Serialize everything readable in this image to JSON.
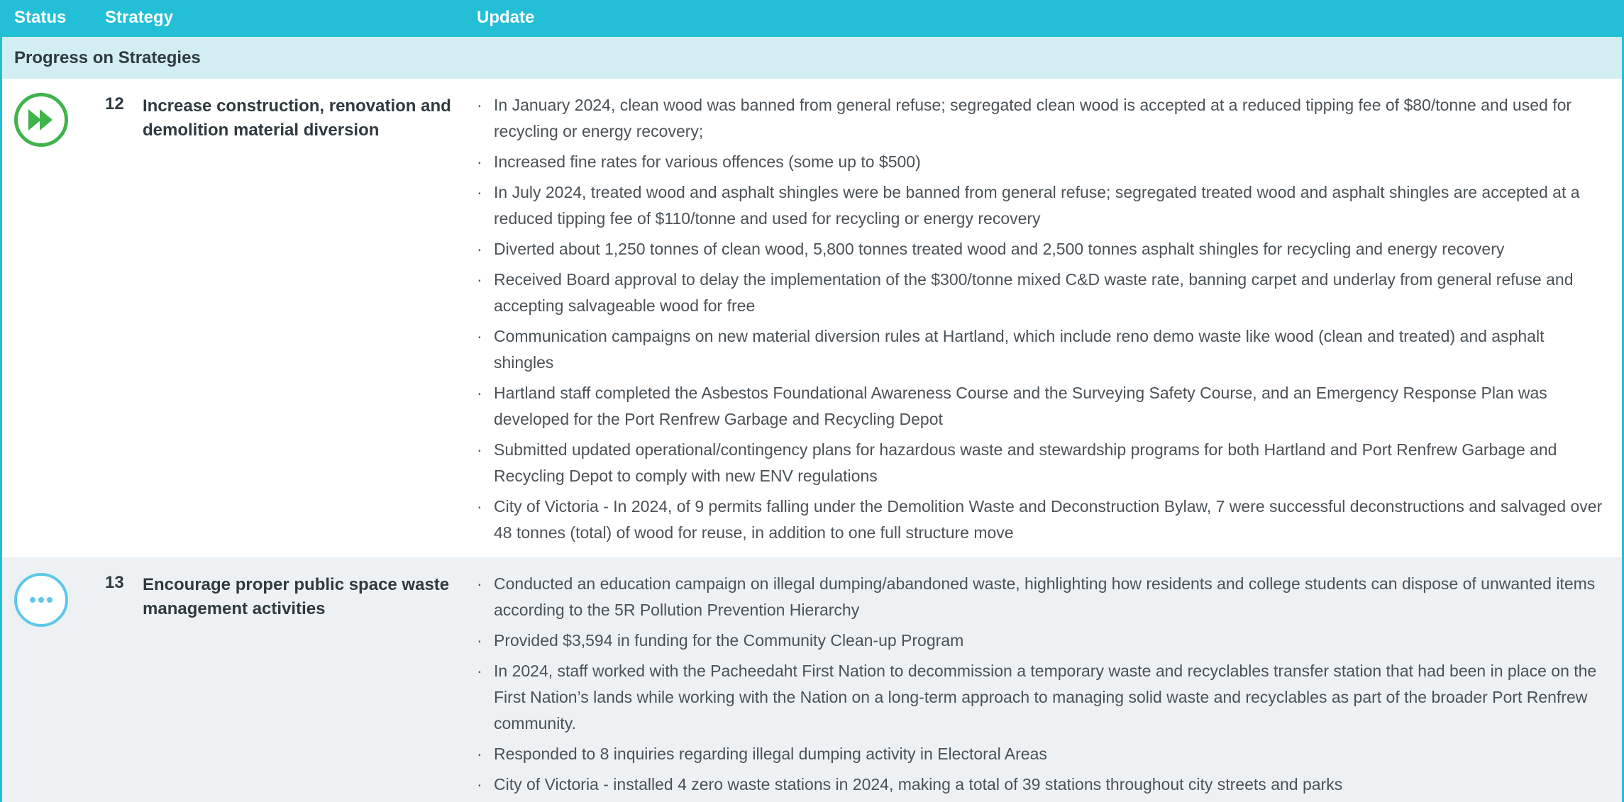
{
  "header": {
    "status": "Status",
    "strategy": "Strategy",
    "update": "Update"
  },
  "section": {
    "title": "Progress on Strategies"
  },
  "rows": [
    {
      "status_icon": "fast-forward-icon",
      "status_color": "#3fb44a",
      "number": "12",
      "title": "Increase construction, renovation and demolition material diversion",
      "updates": [
        "In January 2024, clean wood was banned from general refuse; segregated clean wood is accepted at a reduced tipping fee of $80/tonne and used for recycling or energy recovery;",
        "Increased fine rates for various offences (some up to $500)",
        "In July 2024, treated wood and asphalt shingles were be banned from general refuse; segregated treated wood and asphalt shingles are accepted at a reduced tipping fee of $110/tonne and used for recycling or energy recovery",
        "Diverted about 1,250 tonnes of clean wood, 5,800 tonnes treated wood and 2,500 tonnes asphalt shingles for recycling and energy recovery",
        "Received Board approval to delay the implementation of the $300/tonne mixed C&D waste rate, banning carpet and underlay from general refuse and accepting salvageable wood for free",
        "Communication campaigns on new material diversion rules at Hartland, which include reno demo waste like wood (clean and treated) and asphalt shingles",
        "Hartland staff completed the Asbestos Foundational Awareness Course and the Surveying Safety Course, and an Emergency Response Plan was developed for the Port Renfrew Garbage and Recycling Depot",
        "Submitted updated operational/contingency plans for hazardous waste and stewardship programs for both Hartland and Port Renfrew Garbage and Recycling Depot to comply with new ENV regulations",
        "City of Victoria - In 2024, of 9 permits falling under the Demolition Waste and Deconstruction Bylaw, 7 were successful deconstructions and salvaged over 48 tonnes (total) of wood for reuse, in addition to one full structure move"
      ]
    },
    {
      "status_icon": "ellipsis-icon",
      "status_color": "#5ec8e8",
      "number": "13",
      "title": "Encourage proper public space waste management activities",
      "updates": [
        "Conducted an education campaign on illegal dumping/abandoned waste, highlighting how residents and college students can dispose of unwanted items according to the 5R Pollution Prevention Hierarchy",
        "Provided $3,594 in funding for the Community Clean-up Program",
        "In 2024, staff worked with the Pacheedaht First Nation to decommission a temporary waste and recyclables transfer station that had been in place on the First Nation’s lands while working with the Nation on a long-term approach to managing solid waste and recyclables as part of the broader Port Renfrew community.",
        "Responded to 8 inquiries regarding illegal dumping activity in Electoral Areas",
        "City of Victoria - installed 4 zero waste stations in 2024, making a total of 39 stations throughout city streets and parks"
      ]
    }
  ],
  "colors": {
    "header_bg": "#22bfd6",
    "section_bg": "#d3eef3",
    "alt_row_bg": "#eef1f4"
  }
}
